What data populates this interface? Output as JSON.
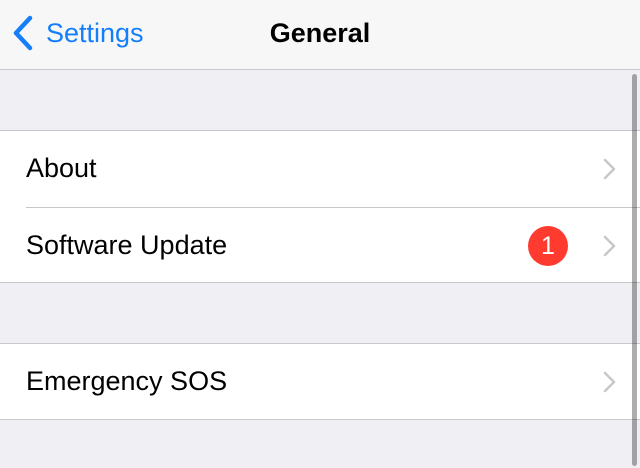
{
  "navbar": {
    "back_label": "Settings",
    "title": "General",
    "back_icon": "chevron-left-icon"
  },
  "groups": [
    {
      "rows": [
        {
          "label": "About",
          "icon": "chevron-right-icon"
        },
        {
          "label": "Software Update",
          "badge": "1",
          "icon": "chevron-right-icon"
        }
      ]
    },
    {
      "rows": [
        {
          "label": "Emergency SOS",
          "icon": "chevron-right-icon"
        }
      ]
    }
  ],
  "colors": {
    "accent": "#157efb",
    "badge": "#ff3b30",
    "background": "#efeff4",
    "separator": "#c8c7cc",
    "chevron": "#c7c7cc"
  }
}
